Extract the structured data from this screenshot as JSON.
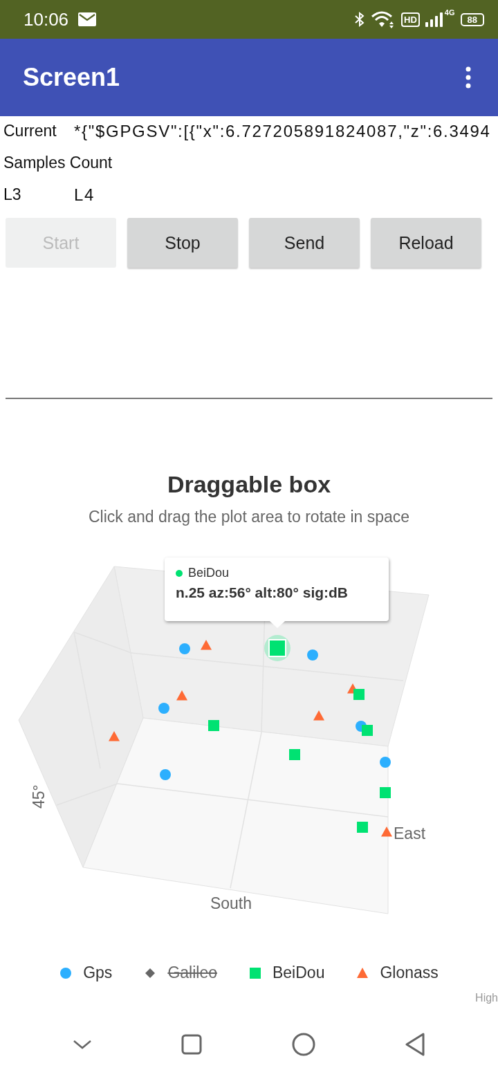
{
  "status_bar": {
    "time": "10:06",
    "hd": "HD",
    "network": "4G",
    "battery": "88"
  },
  "app_bar": {
    "title": "Screen1"
  },
  "fields": [
    {
      "label": "Current",
      "value": "*{\"$GPGSV\":[{\"x\":6.727205891824087,\"z\":6.3494"
    },
    {
      "label": "Samples Count"
    },
    {
      "label": "L3",
      "value": "L4"
    }
  ],
  "buttons": [
    {
      "label": "Start",
      "disabled": true
    },
    {
      "label": "Stop",
      "disabled": false
    },
    {
      "label": "Send",
      "disabled": false
    },
    {
      "label": "Reload",
      "disabled": false
    }
  ],
  "chart": {
    "title": "Draggable box",
    "subtitle": "Click and drag the plot area to rotate in space",
    "ylabel": "45°",
    "xlabel": "South",
    "zlabel": "East",
    "tooltip": {
      "series": "BeiDou",
      "color": "#00e272",
      "text": "n.25 az:56° alt:80° sig:dB"
    },
    "legend": [
      {
        "name": "Gps",
        "kind": "circle",
        "color": "#2caffe",
        "visible": true
      },
      {
        "name": "Galileo",
        "kind": "diamond",
        "visible": false
      },
      {
        "name": "BeiDou",
        "kind": "square",
        "color": "#00e272",
        "visible": true
      },
      {
        "name": "Glonass",
        "kind": "triangle",
        "color": "#fe6a35",
        "visible": true
      }
    ],
    "credit": "High"
  }
}
